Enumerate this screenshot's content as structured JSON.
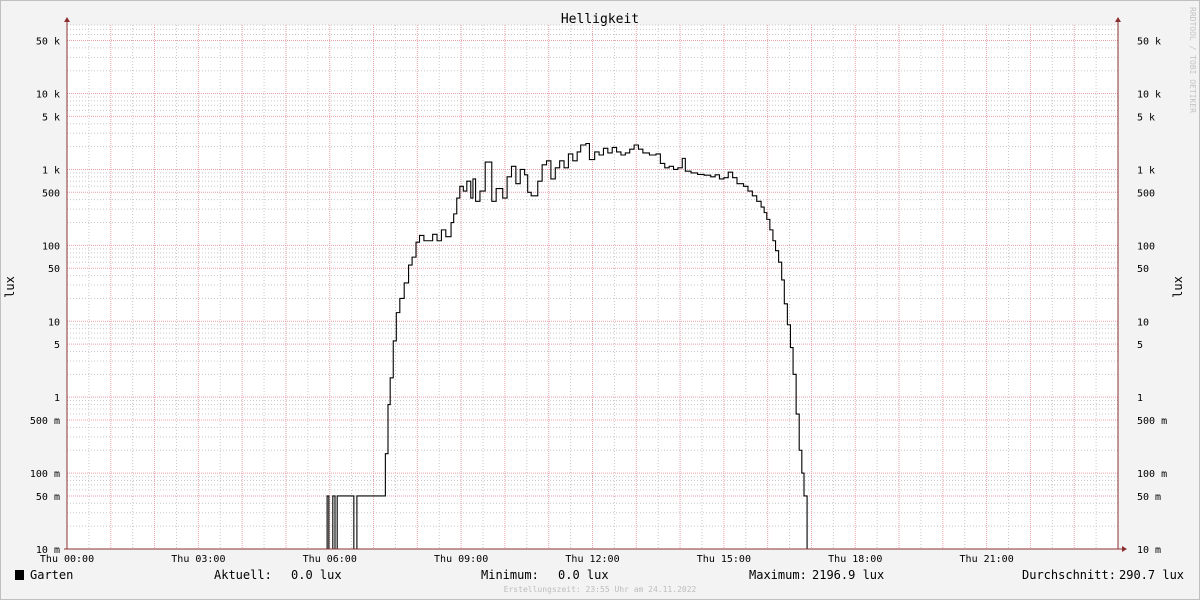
{
  "chart_data": {
    "type": "line",
    "title": "Helligkeit",
    "ylabel": "lux",
    "y_scale": "log",
    "ylim": [
      0.01,
      80000
    ],
    "y_ticks": [
      {
        "value": 0.01,
        "label": "10 m"
      },
      {
        "value": 0.05,
        "label": "50 m"
      },
      {
        "value": 0.1,
        "label": "100 m"
      },
      {
        "value": 0.5,
        "label": "500 m"
      },
      {
        "value": 1,
        "label": "1"
      },
      {
        "value": 5,
        "label": "5"
      },
      {
        "value": 10,
        "label": "10"
      },
      {
        "value": 50,
        "label": "50"
      },
      {
        "value": 100,
        "label": "100"
      },
      {
        "value": 500,
        "label": "500"
      },
      {
        "value": 1000,
        "label": "1 k"
      },
      {
        "value": 5000,
        "label": "5 k"
      },
      {
        "value": 10000,
        "label": "10 k"
      },
      {
        "value": 50000,
        "label": "50 k"
      }
    ],
    "x_unit": "hours",
    "xlim": [
      0,
      24
    ],
    "x_ticks": [
      {
        "value": 0,
        "label": "Thu 00:00"
      },
      {
        "value": 3,
        "label": "Thu 03:00"
      },
      {
        "value": 6,
        "label": "Thu 06:00"
      },
      {
        "value": 9,
        "label": "Thu 09:00"
      },
      {
        "value": 12,
        "label": "Thu 12:00"
      },
      {
        "value": 15,
        "label": "Thu 15:00"
      },
      {
        "value": 18,
        "label": "Thu 18:00"
      },
      {
        "value": 21,
        "label": "Thu 21:00"
      }
    ],
    "grid": true,
    "series": [
      {
        "name": "Garten",
        "color": "#000000",
        "points": [
          [
            0.0,
            0.01
          ],
          [
            5.94,
            0.01
          ],
          [
            5.94,
            0.05
          ],
          [
            5.98,
            0.05
          ],
          [
            5.98,
            0.01
          ],
          [
            6.07,
            0.01
          ],
          [
            6.07,
            0.05
          ],
          [
            6.12,
            0.05
          ],
          [
            6.12,
            0.01
          ],
          [
            6.17,
            0.01
          ],
          [
            6.17,
            0.05
          ],
          [
            6.55,
            0.05
          ],
          [
            6.55,
            0.01
          ],
          [
            6.62,
            0.01
          ],
          [
            6.62,
            0.05
          ],
          [
            7.27,
            0.05
          ],
          [
            7.27,
            0.18
          ],
          [
            7.33,
            0.18
          ],
          [
            7.33,
            0.8
          ],
          [
            7.38,
            0.8
          ],
          [
            7.38,
            1.8
          ],
          [
            7.45,
            1.8
          ],
          [
            7.45,
            5.5
          ],
          [
            7.52,
            5.5
          ],
          [
            7.52,
            13
          ],
          [
            7.6,
            13
          ],
          [
            7.6,
            20
          ],
          [
            7.7,
            20
          ],
          [
            7.7,
            32
          ],
          [
            7.8,
            32
          ],
          [
            7.8,
            55
          ],
          [
            7.88,
            55
          ],
          [
            7.88,
            70
          ],
          [
            7.97,
            70
          ],
          [
            7.97,
            110
          ],
          [
            8.05,
            110
          ],
          [
            8.05,
            135
          ],
          [
            8.15,
            135
          ],
          [
            8.15,
            115
          ],
          [
            8.35,
            115
          ],
          [
            8.35,
            140
          ],
          [
            8.45,
            140
          ],
          [
            8.45,
            115
          ],
          [
            8.55,
            115
          ],
          [
            8.55,
            160
          ],
          [
            8.65,
            160
          ],
          [
            8.65,
            130
          ],
          [
            8.77,
            130
          ],
          [
            8.77,
            200
          ],
          [
            8.83,
            200
          ],
          [
            8.83,
            260
          ],
          [
            8.9,
            260
          ],
          [
            8.9,
            420
          ],
          [
            8.97,
            420
          ],
          [
            8.97,
            600
          ],
          [
            9.05,
            600
          ],
          [
            9.05,
            520
          ],
          [
            9.13,
            520
          ],
          [
            9.13,
            700
          ],
          [
            9.22,
            700
          ],
          [
            9.22,
            420
          ],
          [
            9.27,
            420
          ],
          [
            9.27,
            750
          ],
          [
            9.33,
            750
          ],
          [
            9.33,
            380
          ],
          [
            9.43,
            380
          ],
          [
            9.43,
            520
          ],
          [
            9.55,
            520
          ],
          [
            9.55,
            1250
          ],
          [
            9.7,
            1250
          ],
          [
            9.7,
            380
          ],
          [
            9.8,
            380
          ],
          [
            9.8,
            560
          ],
          [
            9.95,
            560
          ],
          [
            9.95,
            420
          ],
          [
            10.05,
            420
          ],
          [
            10.05,
            800
          ],
          [
            10.15,
            800
          ],
          [
            10.15,
            1100
          ],
          [
            10.25,
            1100
          ],
          [
            10.25,
            650
          ],
          [
            10.35,
            650
          ],
          [
            10.35,
            1000
          ],
          [
            10.45,
            1000
          ],
          [
            10.45,
            850
          ],
          [
            10.52,
            850
          ],
          [
            10.52,
            500
          ],
          [
            10.6,
            500
          ],
          [
            10.6,
            450
          ],
          [
            10.75,
            450
          ],
          [
            10.75,
            700
          ],
          [
            10.85,
            700
          ],
          [
            10.85,
            1150
          ],
          [
            10.95,
            1150
          ],
          [
            10.95,
            1300
          ],
          [
            11.05,
            1300
          ],
          [
            11.05,
            750
          ],
          [
            11.15,
            750
          ],
          [
            11.15,
            1050
          ],
          [
            11.25,
            1050
          ],
          [
            11.25,
            1300
          ],
          [
            11.35,
            1300
          ],
          [
            11.35,
            1050
          ],
          [
            11.45,
            1050
          ],
          [
            11.45,
            1600
          ],
          [
            11.55,
            1600
          ],
          [
            11.55,
            1300
          ],
          [
            11.65,
            1300
          ],
          [
            11.65,
            1700
          ],
          [
            11.73,
            1700
          ],
          [
            11.73,
            2100
          ],
          [
            11.85,
            2100
          ],
          [
            11.85,
            2197
          ],
          [
            11.93,
            2197
          ],
          [
            11.93,
            1350
          ],
          [
            12.05,
            1350
          ],
          [
            12.05,
            1700
          ],
          [
            12.15,
            1700
          ],
          [
            12.15,
            1550
          ],
          [
            12.25,
            1550
          ],
          [
            12.25,
            1900
          ],
          [
            12.35,
            1900
          ],
          [
            12.35,
            1650
          ],
          [
            12.45,
            1650
          ],
          [
            12.45,
            1950
          ],
          [
            12.55,
            1950
          ],
          [
            12.55,
            1700
          ],
          [
            12.65,
            1700
          ],
          [
            12.65,
            1550
          ],
          [
            12.75,
            1550
          ],
          [
            12.75,
            1650
          ],
          [
            12.85,
            1650
          ],
          [
            12.85,
            1850
          ],
          [
            12.95,
            1850
          ],
          [
            12.95,
            2100
          ],
          [
            13.05,
            2100
          ],
          [
            13.05,
            1850
          ],
          [
            13.15,
            1850
          ],
          [
            13.15,
            1650
          ],
          [
            13.3,
            1650
          ],
          [
            13.3,
            1550
          ],
          [
            13.45,
            1550
          ],
          [
            13.45,
            1600
          ],
          [
            13.55,
            1600
          ],
          [
            13.55,
            1200
          ],
          [
            13.65,
            1200
          ],
          [
            13.65,
            1050
          ],
          [
            13.75,
            1050
          ],
          [
            13.75,
            1100
          ],
          [
            13.85,
            1100
          ],
          [
            13.85,
            1000
          ],
          [
            13.95,
            1000
          ],
          [
            13.95,
            1050
          ],
          [
            14.05,
            1050
          ],
          [
            14.05,
            1400
          ],
          [
            14.12,
            1400
          ],
          [
            14.12,
            950
          ],
          [
            14.25,
            950
          ],
          [
            14.25,
            900
          ],
          [
            14.4,
            900
          ],
          [
            14.4,
            860
          ],
          [
            14.55,
            860
          ],
          [
            14.55,
            840
          ],
          [
            14.7,
            840
          ],
          [
            14.7,
            800
          ],
          [
            14.8,
            800
          ],
          [
            14.8,
            850
          ],
          [
            14.9,
            850
          ],
          [
            14.9,
            750
          ],
          [
            15.0,
            750
          ],
          [
            15.0,
            780
          ],
          [
            15.1,
            780
          ],
          [
            15.1,
            920
          ],
          [
            15.2,
            920
          ],
          [
            15.2,
            780
          ],
          [
            15.3,
            780
          ],
          [
            15.3,
            650
          ],
          [
            15.45,
            650
          ],
          [
            15.45,
            600
          ],
          [
            15.55,
            600
          ],
          [
            15.55,
            520
          ],
          [
            15.65,
            520
          ],
          [
            15.65,
            450
          ],
          [
            15.75,
            450
          ],
          [
            15.75,
            380
          ],
          [
            15.85,
            380
          ],
          [
            15.85,
            320
          ],
          [
            15.92,
            320
          ],
          [
            15.92,
            270
          ],
          [
            15.98,
            270
          ],
          [
            15.98,
            220
          ],
          [
            16.05,
            220
          ],
          [
            16.05,
            160
          ],
          [
            16.12,
            160
          ],
          [
            16.12,
            115
          ],
          [
            16.18,
            115
          ],
          [
            16.18,
            85
          ],
          [
            16.25,
            85
          ],
          [
            16.25,
            60
          ],
          [
            16.32,
            60
          ],
          [
            16.32,
            35
          ],
          [
            16.38,
            35
          ],
          [
            16.38,
            17
          ],
          [
            16.45,
            17
          ],
          [
            16.45,
            9
          ],
          [
            16.52,
            9
          ],
          [
            16.52,
            4.5
          ],
          [
            16.58,
            4.5
          ],
          [
            16.58,
            2.0
          ],
          [
            16.65,
            2.0
          ],
          [
            16.65,
            0.6
          ],
          [
            16.72,
            0.6
          ],
          [
            16.72,
            0.2
          ],
          [
            16.78,
            0.2
          ],
          [
            16.78,
            0.1
          ],
          [
            16.83,
            0.1
          ],
          [
            16.83,
            0.05
          ],
          [
            16.9,
            0.05
          ],
          [
            16.9,
            0.01
          ],
          [
            24.0,
            0.01
          ]
        ]
      }
    ],
    "legend": {
      "entries": [
        {
          "label": "Garten",
          "color": "#000000"
        }
      ],
      "placement": "bottom-left"
    },
    "stats": {
      "current_label": "Aktuell:",
      "current_value": "0.0 lux",
      "min_label": "Minimum:",
      "min_value": "0.0 lux",
      "max_label": "Maximum:",
      "max_value": "2196.9 lux",
      "avg_label": "Durchschnitt:",
      "avg_value": "290.7 lux"
    },
    "footer": "Erstellungszeit: 23:55 Uhr am 24.11.2022",
    "watermark": "RRDTOOL / TOBI OETIKER",
    "colors": {
      "background": "#f3f3f3",
      "plot_background": "#ffffff",
      "major_grid": "#e8a0a8",
      "minor_grid": "#c8c8c8",
      "axis": "#8b3030",
      "line": "#000000"
    }
  }
}
